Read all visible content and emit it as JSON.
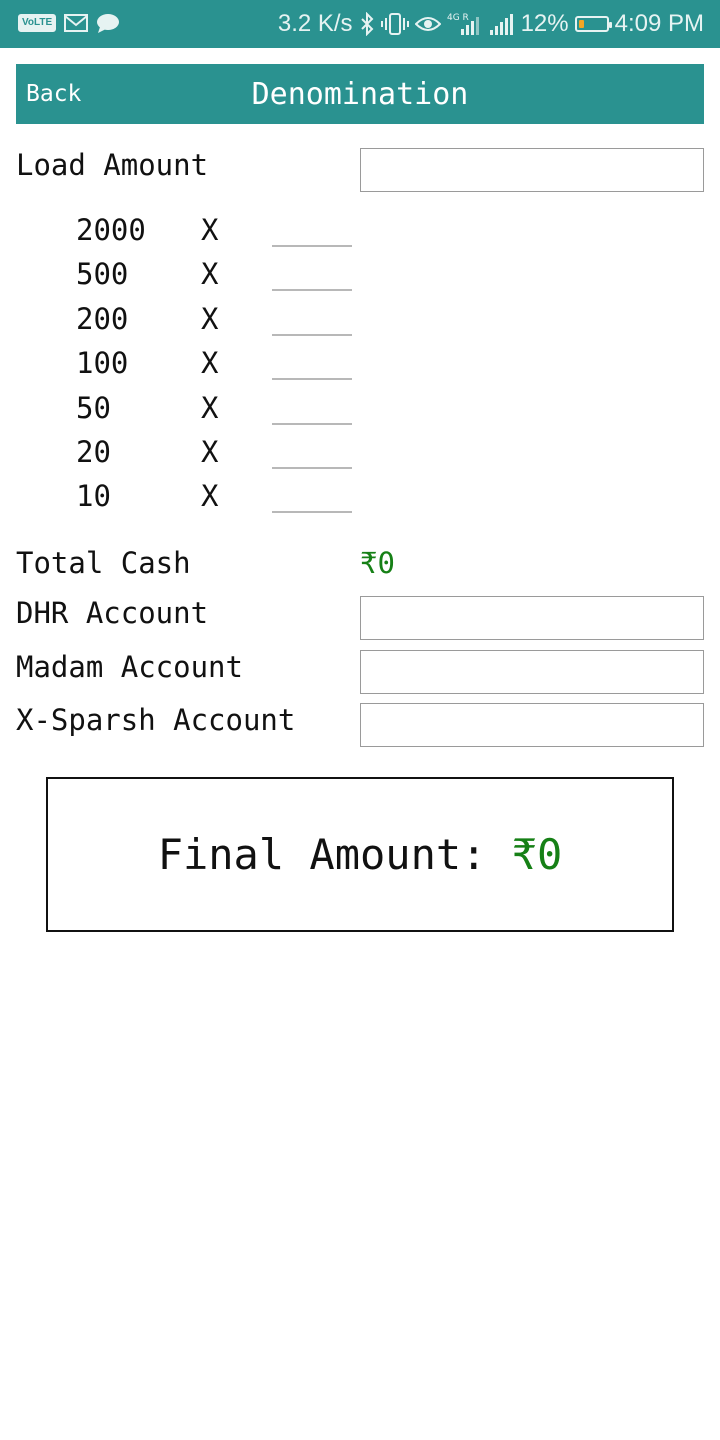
{
  "status_bar": {
    "volte": "VoLTE",
    "net_speed": "3.2 K/s",
    "network_type": "4G R",
    "battery_percent": "12%",
    "time": "4:09 PM",
    "icons": [
      "volte-icon",
      "gmail-icon",
      "message-icon",
      "bluetooth-icon",
      "vibrate-icon",
      "eye-icon",
      "signal-4g-icon",
      "signal-icon",
      "battery-icon"
    ]
  },
  "header": {
    "back_label": "Back",
    "title": "Denomination",
    "color": "#2a9290"
  },
  "load_amount": {
    "label": "Load Amount",
    "value": ""
  },
  "denominations": [
    {
      "value": "2000",
      "mult": "X",
      "qty": ""
    },
    {
      "value": "500",
      "mult": "X",
      "qty": ""
    },
    {
      "value": "200",
      "mult": "X",
      "qty": ""
    },
    {
      "value": "100",
      "mult": "X",
      "qty": ""
    },
    {
      "value": "50",
      "mult": "X",
      "qty": ""
    },
    {
      "value": "20",
      "mult": "X",
      "qty": ""
    },
    {
      "value": "10",
      "mult": "X",
      "qty": ""
    }
  ],
  "total_cash": {
    "label": "Total Cash",
    "value": "₹0",
    "color": "#168016"
  },
  "accounts": [
    {
      "label": "DHR Account",
      "value": ""
    },
    {
      "label": "Madam Account",
      "value": ""
    },
    {
      "label": "X-Sparsh Account",
      "value": ""
    }
  ],
  "final_amount": {
    "label": "Final Amount: ",
    "value": "₹0"
  }
}
